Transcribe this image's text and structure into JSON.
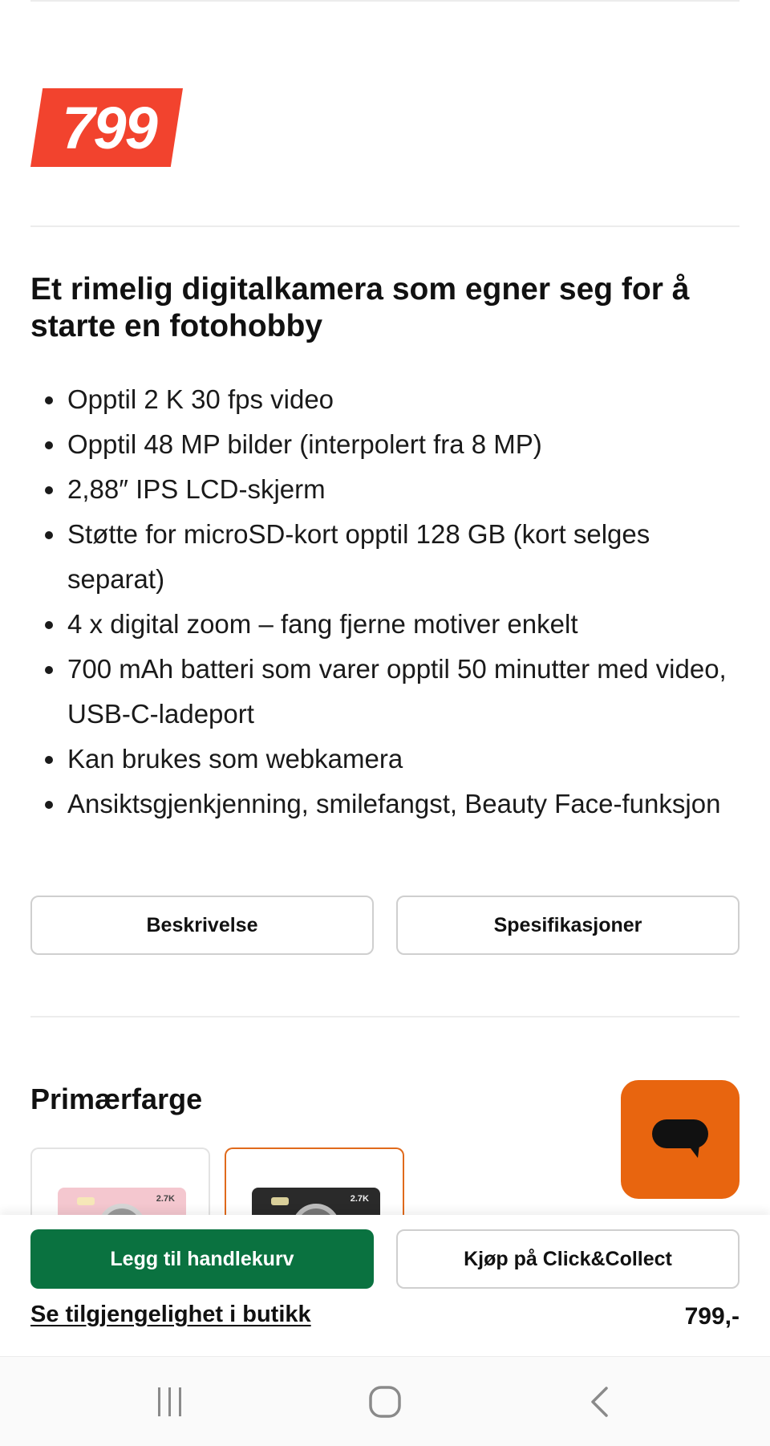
{
  "price_badge": {
    "value": "799"
  },
  "headline": "Et rimelig digitalkamera som egner seg for å starte en fotohobby",
  "features": [
    "Opptil 2 K 30 fps video",
    "Opptil 48 MP bilder (interpolert fra 8 MP)",
    "2,88″ IPS LCD-skjerm",
    "Støtte for microSD-kort opptil 128 GB (kort selges separat)",
    "4 x digital zoom – fang fjerne motiver enkelt",
    "700 mAh batteri som varer opptil 50 minutter med video, USB-C-ladeport",
    "Kan brukes som webkamera",
    "Ansiktsgjenkjenning, smilefangst, Beauty Face-funksjon"
  ],
  "tabs": {
    "description_label": "Beskrivelse",
    "specifications_label": "Spesifikasjoner"
  },
  "color_section": {
    "title": "Primærfarge",
    "swatches": [
      {
        "color_name": "pink",
        "camera_color": "#f4c7cf",
        "tag": "2.7K",
        "selected": false
      },
      {
        "color_name": "black",
        "camera_color": "#2a2a2a",
        "tag": "2.7K",
        "selected": true
      }
    ]
  },
  "chat": {
    "icon": "chat-bubble-icon"
  },
  "bottom_bar": {
    "add_to_cart_label": "Legg til handlekurv",
    "click_collect_label": "Kjøp på Click&Collect",
    "store_availability_label": "Se tilgjengelighet i butikk",
    "price": "799,-"
  },
  "colors": {
    "price_badge": "#f2432e",
    "cart_button": "#0a7240",
    "chat_fab": "#e8650f",
    "selected_swatch_border": "#e06a1c"
  },
  "system_nav": {
    "recents_icon": "recents-icon",
    "home_icon": "home-icon",
    "back_icon": "back-icon"
  }
}
